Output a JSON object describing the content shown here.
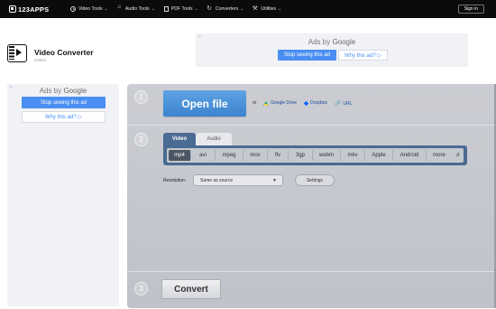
{
  "topbar": {
    "logo": "123APPS",
    "nav": [
      {
        "label": "Video Tools",
        "icon": "play-circle-icon"
      },
      {
        "label": "Audio Tools",
        "icon": "music-note-icon"
      },
      {
        "label": "PDF Tools",
        "icon": "document-icon"
      },
      {
        "label": "Converters",
        "icon": "convert-cycle-icon"
      },
      {
        "label": "Utilities",
        "icon": "tools-icon"
      }
    ],
    "signin": "Sign in"
  },
  "app": {
    "title": "Video Converter",
    "subtitle": "Online"
  },
  "ads": {
    "back": "←",
    "by_prefix": "Ads by ",
    "by_brand": "Google",
    "stop": "Stop seeing this ad",
    "why": "Why this ad? ▷"
  },
  "converter": {
    "steps": [
      "1",
      "2",
      "3"
    ],
    "open_file": "Open file",
    "or": "or",
    "sources": [
      {
        "label": "Google Drive",
        "icon": "google-drive-icon"
      },
      {
        "label": "Dropbox",
        "icon": "dropbox-icon"
      },
      {
        "label": "URL",
        "icon": "link-icon"
      }
    ],
    "tabs": [
      "Video",
      "Audio"
    ],
    "active_tab": "Video",
    "formats": [
      "mp4",
      "avi",
      "mpeg",
      "mov",
      "flv",
      "3gp",
      "webm",
      "mkv",
      "Apple",
      "Android",
      "more"
    ],
    "selected_format": "mp4",
    "resolution_label": "Resolution:",
    "resolution_value": "Same as source",
    "settings": "Settings",
    "convert": "Convert"
  },
  "colors": {
    "topbar": "#0b0b0b",
    "accent": "#4a8ef2",
    "open_button": "#4a8fd8",
    "format_bar": "#4a6b92",
    "panel": "#c5c8ce"
  }
}
